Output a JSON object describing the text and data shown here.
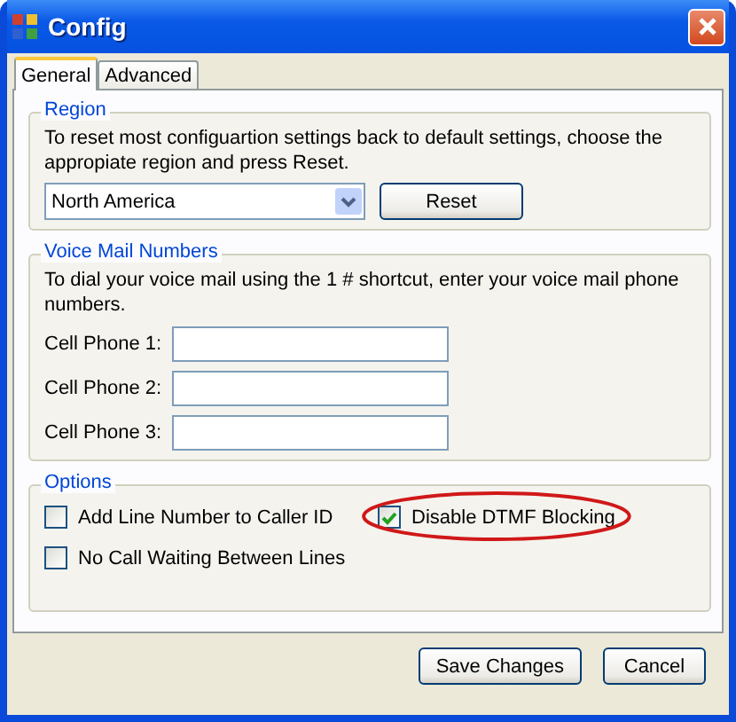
{
  "window": {
    "title": "Config"
  },
  "tabs": [
    {
      "label": "General",
      "selected": true
    },
    {
      "label": "Advanced",
      "selected": false
    }
  ],
  "region": {
    "title": "Region",
    "description": "To reset most configuartion settings back to default settings, choose the appropiate region and press Reset.",
    "dropdown": {
      "value": "North America"
    },
    "button": "Reset"
  },
  "voice_mail": {
    "title": "Voice Mail Numbers",
    "description": "To dial your voice mail using the 1 # shortcut, enter your voice mail phone numbers.",
    "fields": [
      {
        "label": "Cell Phone 1:"
      },
      {
        "label": "Cell Phone 2:"
      },
      {
        "label": "Cell Phone 3:"
      }
    ]
  },
  "options": {
    "title": "Options",
    "items": [
      {
        "label": "Add Line Number to Caller ID",
        "checked": false,
        "circled": false
      },
      {
        "label": "Disable DTMF Blocking",
        "checked": true,
        "circled": true
      },
      {
        "label": "No Call Waiting Between Lines",
        "checked": false,
        "circled": false
      }
    ]
  },
  "buttons": [
    "Save Changes",
    "Cancel"
  ]
}
